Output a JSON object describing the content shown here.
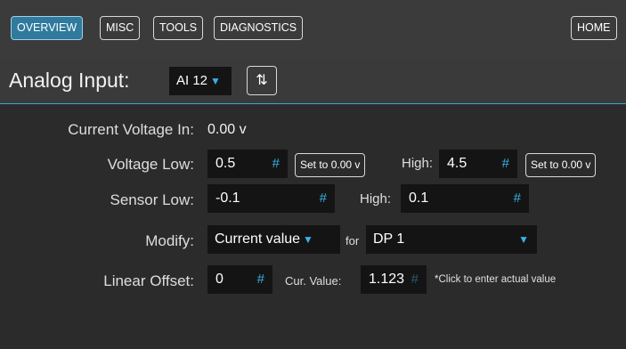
{
  "nav": {
    "overview": "OVERVIEW",
    "misc": "MISC",
    "tools": "TOOLS",
    "diagnostics": "DIAGNOSTICS",
    "home": "HOME"
  },
  "header": {
    "title": "Analog Input:",
    "input_select": "AI 12",
    "sort_icon": "⇅"
  },
  "form": {
    "current_voltage_label": "Current Voltage In:",
    "current_voltage_value": "0.00 v",
    "voltage_low_label": "Voltage Low:",
    "voltage_low_value": "0.5",
    "voltage_low_set_button": "Set to 0.00 v",
    "voltage_high_label": "High:",
    "voltage_high_value": "4.5",
    "voltage_high_set_button": "Set to 0.00 v",
    "sensor_low_label": "Sensor Low:",
    "sensor_low_value": "-0.1",
    "sensor_high_label": "High:",
    "sensor_high_value": "0.1",
    "modify_label": "Modify:",
    "modify_select": "Current value",
    "for_label": "for",
    "dp_select": "DP 1",
    "linear_offset_label": "Linear Offset:",
    "linear_offset_value": "0",
    "cur_value_label": "Cur. Value:",
    "cur_value_value": "1.123",
    "cur_value_note": "*Click to enter actual value"
  },
  "icons": {
    "hash": "#",
    "caret": "▼"
  },
  "colors": {
    "accent": "#39b1e8",
    "active_tab": "#2f7a9d",
    "background": "#2b2b2b",
    "field_bg": "#141414"
  }
}
